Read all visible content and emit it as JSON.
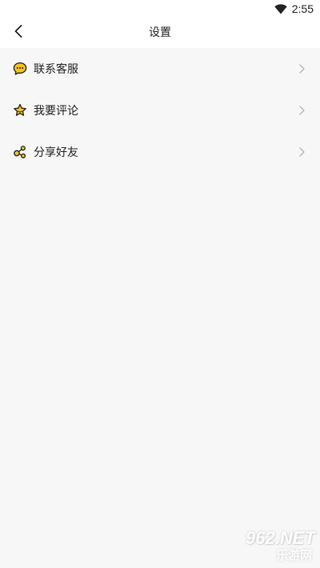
{
  "status_bar": {
    "time": "2:55",
    "wifi_icon": "wifi-icon"
  },
  "header": {
    "title": "设置",
    "back_icon": "back-arrow-icon"
  },
  "settings": {
    "items": [
      {
        "label": "联系客服",
        "icon": "chat-bubble-icon"
      },
      {
        "label": "我要评论",
        "icon": "star-icon"
      },
      {
        "label": "分享好友",
        "icon": "share-icon"
      }
    ]
  },
  "colors": {
    "icon_fill": "#f5c21b",
    "icon_stroke": "#222222",
    "chevron": "#b5b5b5",
    "background": "#f7f7f7",
    "bar_background": "#ffffff"
  },
  "watermark": {
    "top_text": "962.NET",
    "bottom_text": "乐游网"
  }
}
